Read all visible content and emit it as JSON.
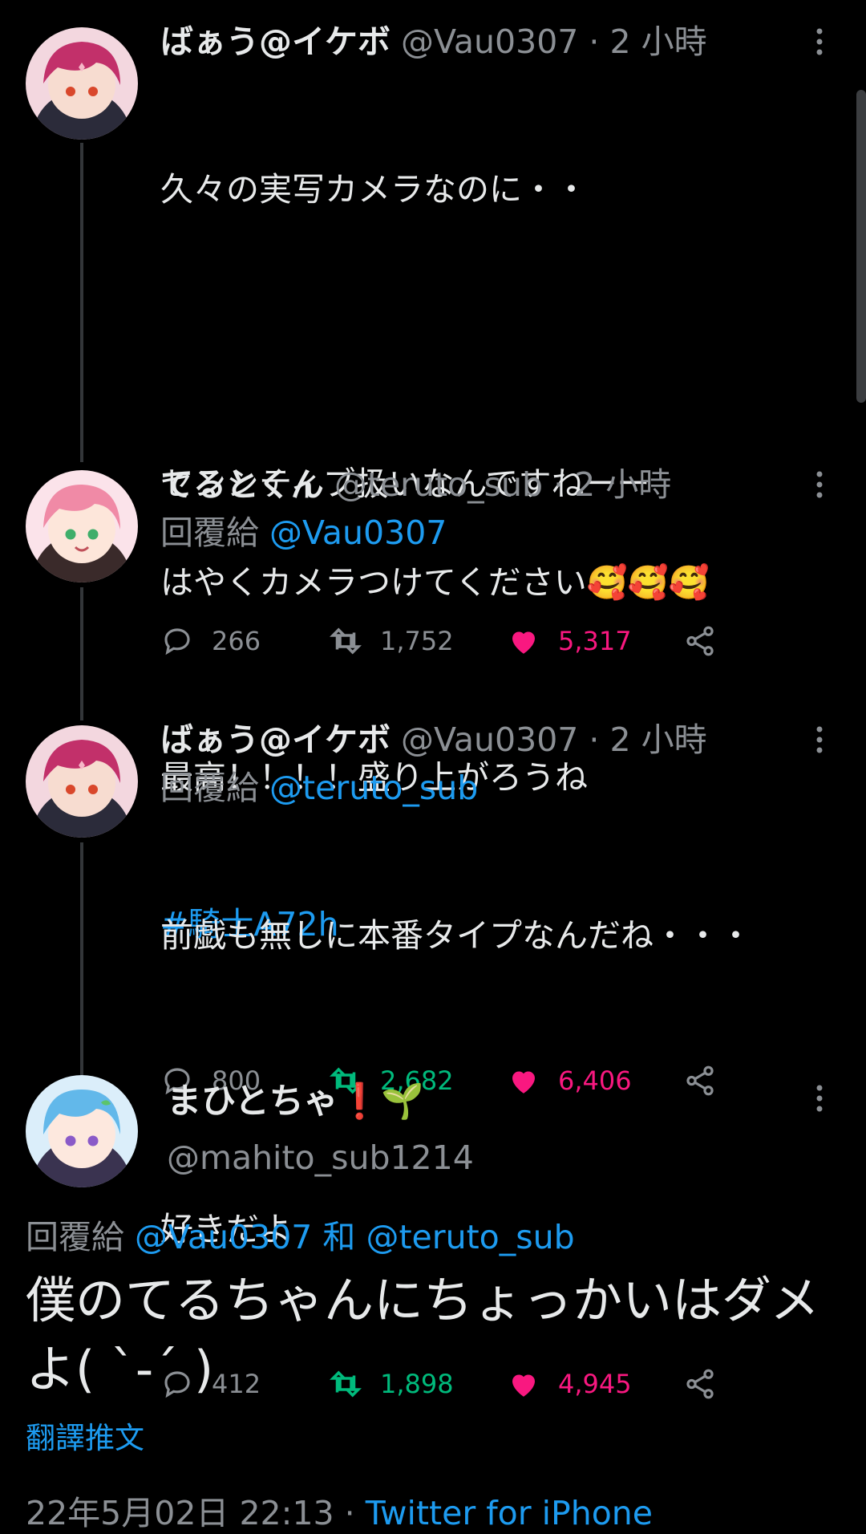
{
  "tweets": [
    {
      "name": "ばぁう@イケボ",
      "handle": "@Vau0307",
      "sep": "·",
      "time": "2 小時",
      "lines": [
        "久々の実写カメラなのに・・",
        "",
        "センシティブ扱いなんですねーー",
        "",
        "最高！！！！盛り上がろうね"
      ],
      "hashtag": "#騎士A72h",
      "replies": "800",
      "retweets": "2,682",
      "likes": "6,406"
    },
    {
      "name": "てるとくん",
      "handle": "@teruto_sub",
      "sep": "·",
      "time": "2 小時",
      "reply_prefix": "回覆給",
      "reply_to": "@Vau0307",
      "text": "はやくカメラつけてください🥰🥰🥰",
      "replies": "266",
      "retweets": "1,752",
      "likes": "5,317"
    },
    {
      "name": "ばぁう@イケボ",
      "handle": "@Vau0307",
      "sep": "·",
      "time": "2 小時",
      "reply_prefix": "回覆給",
      "reply_to": "@teruto_sub",
      "lines": [
        "前戯も無しに本番タイプなんだね・・・",
        "",
        "好きだよ"
      ],
      "replies": "412",
      "retweets": "1,898",
      "likes": "4,945"
    }
  ],
  "main_tweet": {
    "name": "まひとちゃ❗🌱",
    "handle": "@mahito_sub1214",
    "reply_prefix": "回覆給",
    "reply_to_1": "@Vau0307",
    "reply_and": "和",
    "reply_to_2": "@teruto_sub",
    "text": "僕のてるちゃんにちょっかいはダメよ( ˋ-ˊ )",
    "translate_label": "翻譯推文",
    "timestamp": "22年5月02日 22:13",
    "meta_sep": "·",
    "source": "Twitter for iPhone"
  },
  "icons": [
    "reply-icon",
    "retweet-icon",
    "like-icon",
    "share-icon",
    "more-icon"
  ],
  "colors": {
    "background": "#000000",
    "text": "#e7e9ea",
    "secondary": "#8b8f94",
    "link": "#1d9bf0",
    "retweet_active": "#00ba7c",
    "like_active": "#f91880"
  }
}
